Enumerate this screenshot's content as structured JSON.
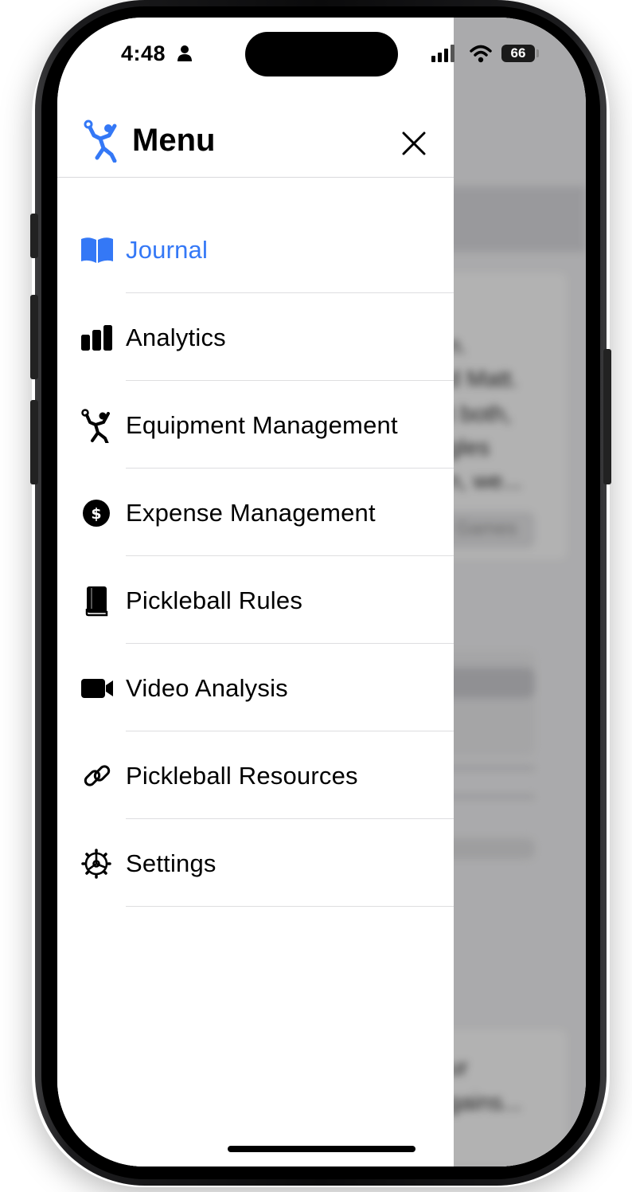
{
  "status_bar": {
    "time": "4:48",
    "battery": "66"
  },
  "header": {
    "title": "Menu",
    "logo_icon": "pickleball-player-icon",
    "close_icon": "close-icon"
  },
  "menu": {
    "items": [
      {
        "label": "Journal",
        "icon": "book-open-icon",
        "active": true
      },
      {
        "label": "Analytics",
        "icon": "bar-chart-icon",
        "active": false
      },
      {
        "label": "Equipment Management",
        "icon": "pickleball-player-icon",
        "active": false
      },
      {
        "label": "Expense Management",
        "icon": "dollar-circle-icon",
        "active": false
      },
      {
        "label": "Pickleball Rules",
        "icon": "book-closed-icon",
        "active": false
      },
      {
        "label": "Video Analysis",
        "icon": "video-camera-icon",
        "active": false
      },
      {
        "label": "Pickleball Resources",
        "icon": "link-icon",
        "active": false
      },
      {
        "label": "Settings",
        "icon": "gear-icon",
        "active": false
      }
    ]
  },
  "background": {
    "snippets": [
      "n.",
      "d Matt.",
      "t both,",
      "gles",
      "n, we...",
      "Games",
      "ur",
      "gains..."
    ]
  },
  "colors": {
    "accent": "#3478f6",
    "text": "#000000",
    "divider": "#dedee0"
  }
}
